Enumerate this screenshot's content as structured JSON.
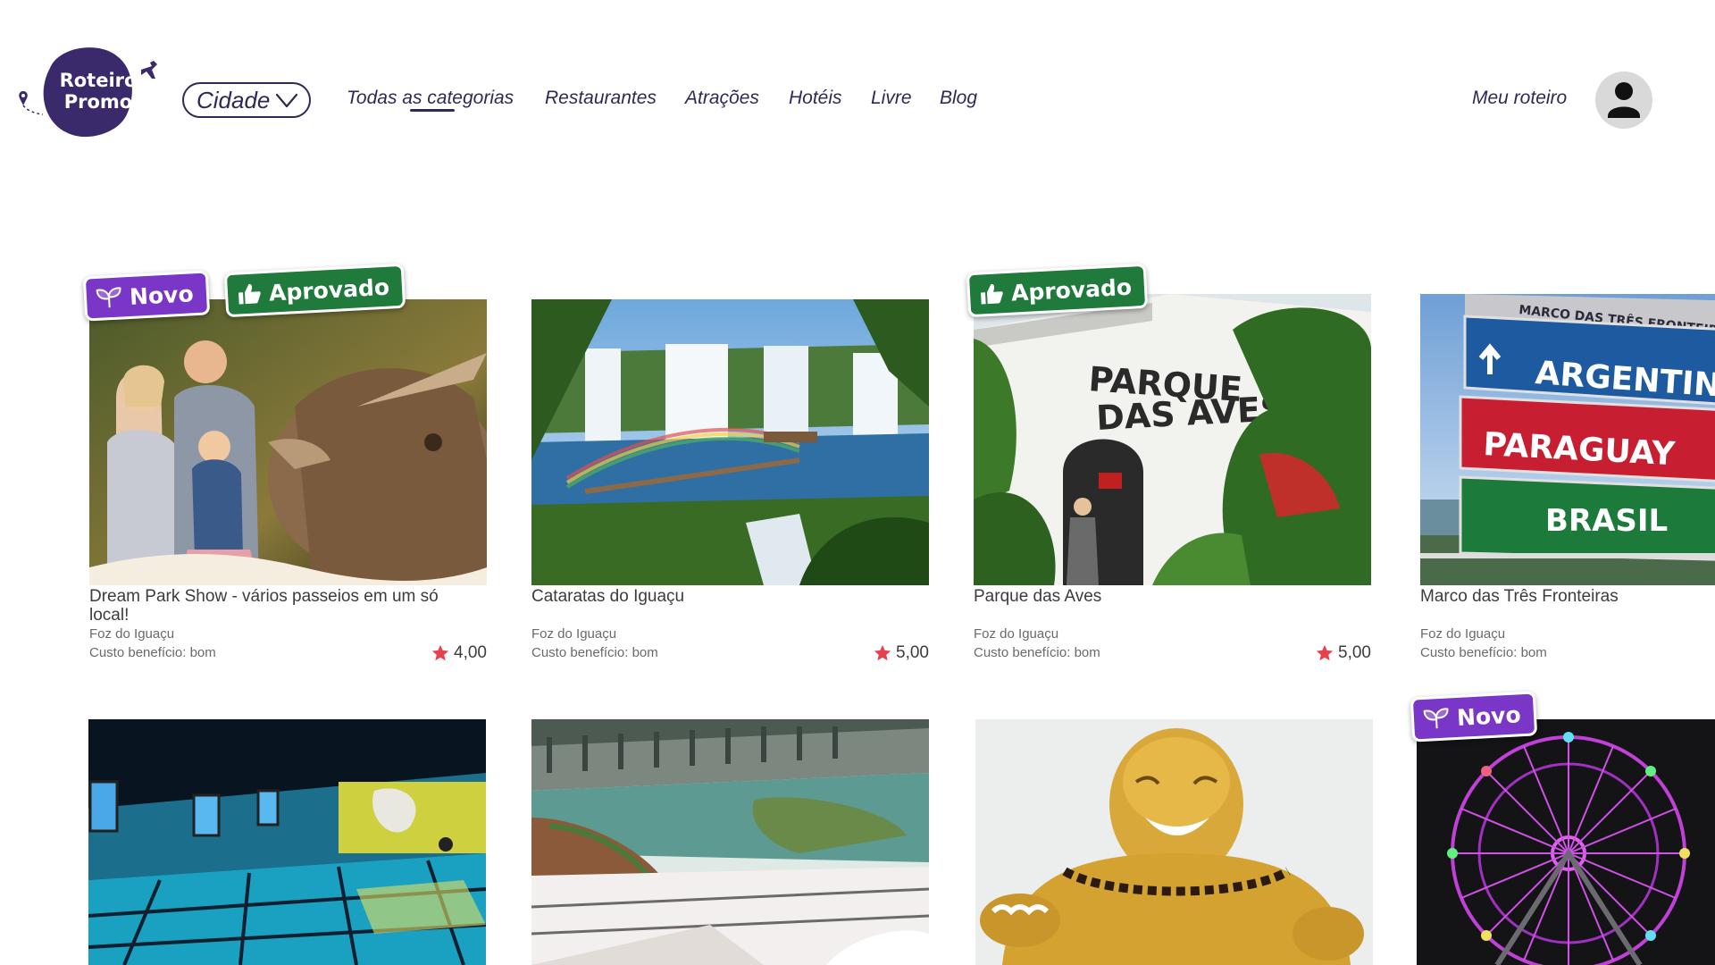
{
  "brand": {
    "name_line1": "Roteiro",
    "name_line2": "Promo"
  },
  "header": {
    "city_selector": "Cidade",
    "nav": [
      {
        "label": "Todas as categorias",
        "active": true
      },
      {
        "label": "Restaurantes"
      },
      {
        "label": "Atrações"
      },
      {
        "label": "Hotéis"
      },
      {
        "label": "Livre"
      },
      {
        "label": "Blog"
      }
    ],
    "my_trip": "Meu roteiro"
  },
  "badges": {
    "novo": "Novo",
    "aprovado": "Aprovado"
  },
  "colors": {
    "brand_purple": "#3b2a6b",
    "novo_badge": "#7a36c6",
    "aprovado_badge": "#1f7a3c",
    "star": "#e8414e",
    "text_dark": "#2d2a55"
  },
  "cards": [
    {
      "title": "Dream Park Show - vários passeios em um só local!",
      "city": "Foz do Iguaçu",
      "value": "Custo benefício: bom",
      "rating": "4,00",
      "badges": [
        "novo",
        "aprovado"
      ]
    },
    {
      "title": "Cataratas do Iguaçu",
      "city": "Foz do Iguaçu",
      "value": "Custo benefício: bom",
      "rating": "5,00",
      "badges": []
    },
    {
      "title": "Parque das Aves",
      "city": "Foz do Iguaçu",
      "value": "Custo benefício: bom",
      "rating": "5,00",
      "badges": [
        "aprovado"
      ]
    },
    {
      "title": "Marco das Três Fronteiras",
      "city": "Foz do Iguaçu",
      "value": "Custo benefício: bom",
      "rating": "",
      "badges": []
    },
    {
      "title": "",
      "badges": []
    },
    {
      "title": "",
      "badges": []
    },
    {
      "title": "",
      "badges": []
    },
    {
      "title": "",
      "badges": [
        "novo"
      ]
    }
  ],
  "image_text": {
    "parque_sign_1": "PARQUE",
    "parque_sign_2": "DAS AVES",
    "marco_sign_top": "MARCO DAS TRÊS FRONTEIRAS",
    "marco_argentina": "ARGENTINA",
    "marco_paraguay": "PARAGUAY",
    "marco_brasil": "BRASIL"
  }
}
